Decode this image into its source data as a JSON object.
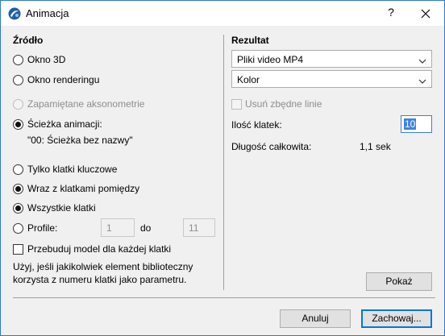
{
  "window": {
    "title": "Animacja",
    "help_label": "?"
  },
  "source": {
    "title": "Źródło",
    "options": {
      "view3d": "Okno 3D",
      "rendering": "Okno renderingu",
      "saved_axonometry": "Zapamiętane aksonometrie",
      "animation_path": "Ścieżka animacji:"
    },
    "path_name": "\"00: Ścieżka bez nazwy\"",
    "frames_options": {
      "keyframes_only": "Tylko klatki kluczowe",
      "with_inbetween": "Wraz z klatkami pomiędzy"
    },
    "range_options": {
      "all_frames": "Wszystkie klatki",
      "profile": "Profile:"
    },
    "profile_from": "1",
    "profile_to_label": "do",
    "profile_to": "11",
    "rebuild_label": "Przebuduj model dla każdej klatki",
    "note": "Użyj, jeśli jakikolwiek element biblioteczny korzysta z numeru klatki jako parametru."
  },
  "result": {
    "title": "Rezultat",
    "format_value": "Pliki video MP4",
    "color_value": "Kolor",
    "remove_lines_label": "Usuń zbędne linie",
    "frame_count_label": "Ilość klatek:",
    "frame_count_value": "10",
    "total_length_label": "Długość całkowita:",
    "total_length_value": "1,1 sek",
    "show_label": "Pokaż"
  },
  "footer": {
    "cancel_label": "Anuluj",
    "save_label": "Zachowaj..."
  },
  "state": {
    "source_selected": "animation_path",
    "frames_selected": "with_inbetween",
    "range_selected": "all_frames",
    "rebuild_checked": false,
    "remove_lines_checked": false,
    "remove_lines_disabled": true,
    "saved_axonometry_disabled": true
  },
  "colors": {
    "accent": "#0078d7",
    "window_border": "#2b79d3",
    "disabled_text": "#8d8d8d",
    "selection": "#3b84e0"
  }
}
